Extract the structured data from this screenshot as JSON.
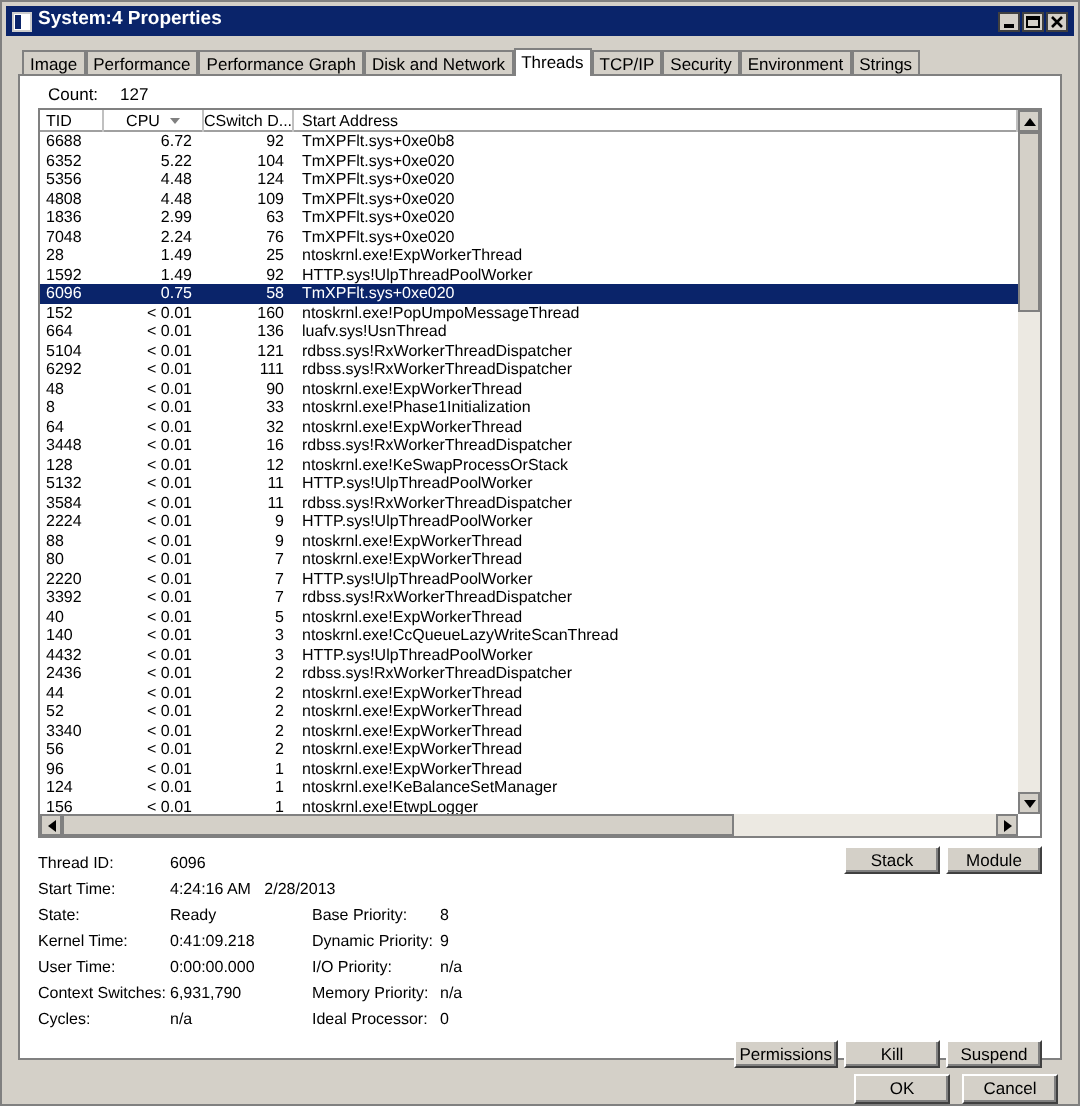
{
  "window": {
    "title": "System:4 Properties"
  },
  "tabs": [
    {
      "label": "Image",
      "selected": false
    },
    {
      "label": "Performance",
      "selected": false
    },
    {
      "label": "Performance Graph",
      "selected": false
    },
    {
      "label": "Disk and Network",
      "selected": false
    },
    {
      "label": "Threads",
      "selected": true
    },
    {
      "label": "TCP/IP",
      "selected": false
    },
    {
      "label": "Security",
      "selected": false
    },
    {
      "label": "Environment",
      "selected": false
    },
    {
      "label": "Strings",
      "selected": false
    }
  ],
  "count": {
    "label": "Count:",
    "value": "127"
  },
  "table": {
    "columns": [
      {
        "label": "TID",
        "sorted": false
      },
      {
        "label": "CPU",
        "sorted": true
      },
      {
        "label": "CSwitch D...",
        "sorted": false
      },
      {
        "label": "Start Address",
        "sorted": false
      }
    ],
    "rows": [
      {
        "cells": [
          "6688",
          "6.72",
          "92",
          "TmXPFlt.sys+0xe0b8"
        ],
        "selected": false
      },
      {
        "cells": [
          "6352",
          "5.22",
          "104",
          "TmXPFlt.sys+0xe020"
        ],
        "selected": false
      },
      {
        "cells": [
          "5356",
          "4.48",
          "124",
          "TmXPFlt.sys+0xe020"
        ],
        "selected": false
      },
      {
        "cells": [
          "4808",
          "4.48",
          "109",
          "TmXPFlt.sys+0xe020"
        ],
        "selected": false
      },
      {
        "cells": [
          "1836",
          "2.99",
          "63",
          "TmXPFlt.sys+0xe020"
        ],
        "selected": false
      },
      {
        "cells": [
          "7048",
          "2.24",
          "76",
          "TmXPFlt.sys+0xe020"
        ],
        "selected": false
      },
      {
        "cells": [
          "28",
          "1.49",
          "25",
          "ntoskrnl.exe!ExpWorkerThread"
        ],
        "selected": false
      },
      {
        "cells": [
          "1592",
          "1.49",
          "92",
          "HTTP.sys!UlpThreadPoolWorker"
        ],
        "selected": false
      },
      {
        "cells": [
          "6096",
          "0.75",
          "58",
          "TmXPFlt.sys+0xe020"
        ],
        "selected": true
      },
      {
        "cells": [
          "152",
          "< 0.01",
          "160",
          "ntoskrnl.exe!PopUmpoMessageThread"
        ],
        "selected": false
      },
      {
        "cells": [
          "664",
          "< 0.01",
          "136",
          "luafv.sys!UsnThread"
        ],
        "selected": false
      },
      {
        "cells": [
          "5104",
          "< 0.01",
          "121",
          "rdbss.sys!RxWorkerThreadDispatcher"
        ],
        "selected": false
      },
      {
        "cells": [
          "6292",
          "< 0.01",
          "111",
          "rdbss.sys!RxWorkerThreadDispatcher"
        ],
        "selected": false
      },
      {
        "cells": [
          "48",
          "< 0.01",
          "90",
          "ntoskrnl.exe!ExpWorkerThread"
        ],
        "selected": false
      },
      {
        "cells": [
          "8",
          "< 0.01",
          "33",
          "ntoskrnl.exe!Phase1Initialization"
        ],
        "selected": false
      },
      {
        "cells": [
          "64",
          "< 0.01",
          "32",
          "ntoskrnl.exe!ExpWorkerThread"
        ],
        "selected": false
      },
      {
        "cells": [
          "3448",
          "< 0.01",
          "16",
          "rdbss.sys!RxWorkerThreadDispatcher"
        ],
        "selected": false
      },
      {
        "cells": [
          "128",
          "< 0.01",
          "12",
          "ntoskrnl.exe!KeSwapProcessOrStack"
        ],
        "selected": false
      },
      {
        "cells": [
          "5132",
          "< 0.01",
          "11",
          "HTTP.sys!UlpThreadPoolWorker"
        ],
        "selected": false
      },
      {
        "cells": [
          "3584",
          "< 0.01",
          "11",
          "rdbss.sys!RxWorkerThreadDispatcher"
        ],
        "selected": false
      },
      {
        "cells": [
          "2224",
          "< 0.01",
          "9",
          "HTTP.sys!UlpThreadPoolWorker"
        ],
        "selected": false
      },
      {
        "cells": [
          "88",
          "< 0.01",
          "9",
          "ntoskrnl.exe!ExpWorkerThread"
        ],
        "selected": false
      },
      {
        "cells": [
          "80",
          "< 0.01",
          "7",
          "ntoskrnl.exe!ExpWorkerThread"
        ],
        "selected": false
      },
      {
        "cells": [
          "2220",
          "< 0.01",
          "7",
          "HTTP.sys!UlpThreadPoolWorker"
        ],
        "selected": false
      },
      {
        "cells": [
          "3392",
          "< 0.01",
          "7",
          "rdbss.sys!RxWorkerThreadDispatcher"
        ],
        "selected": false
      },
      {
        "cells": [
          "40",
          "< 0.01",
          "5",
          "ntoskrnl.exe!ExpWorkerThread"
        ],
        "selected": false
      },
      {
        "cells": [
          "140",
          "< 0.01",
          "3",
          "ntoskrnl.exe!CcQueueLazyWriteScanThread"
        ],
        "selected": false
      },
      {
        "cells": [
          "4432",
          "< 0.01",
          "3",
          "HTTP.sys!UlpThreadPoolWorker"
        ],
        "selected": false
      },
      {
        "cells": [
          "2436",
          "< 0.01",
          "2",
          "rdbss.sys!RxWorkerThreadDispatcher"
        ],
        "selected": false
      },
      {
        "cells": [
          "44",
          "< 0.01",
          "2",
          "ntoskrnl.exe!ExpWorkerThread"
        ],
        "selected": false
      },
      {
        "cells": [
          "52",
          "< 0.01",
          "2",
          "ntoskrnl.exe!ExpWorkerThread"
        ],
        "selected": false
      },
      {
        "cells": [
          "3340",
          "< 0.01",
          "2",
          "ntoskrnl.exe!ExpWorkerThread"
        ],
        "selected": false
      },
      {
        "cells": [
          "56",
          "< 0.01",
          "2",
          "ntoskrnl.exe!ExpWorkerThread"
        ],
        "selected": false
      },
      {
        "cells": [
          "96",
          "< 0.01",
          "1",
          "ntoskrnl.exe!ExpWorkerThread"
        ],
        "selected": false
      },
      {
        "cells": [
          "124",
          "< 0.01",
          "1",
          "ntoskrnl.exe!KeBalanceSetManager"
        ],
        "selected": false
      },
      {
        "cells": [
          "156",
          "< 0.01",
          "1",
          "ntoskrnl.exe!EtwpLogger"
        ],
        "selected": false
      }
    ]
  },
  "details": {
    "top": [
      {
        "label": "Thread ID:",
        "value": "6096"
      },
      {
        "label": "Start Time:",
        "value": "4:24:16 AM   2/28/2013"
      }
    ],
    "left": [
      {
        "label": "State:",
        "value": "Ready"
      },
      {
        "label": "Kernel Time:",
        "value": "0:41:09.218"
      },
      {
        "label": "User Time:",
        "value": "0:00:00.000"
      },
      {
        "label": "Context Switches:",
        "value": "6,931,790"
      },
      {
        "label": "Cycles:",
        "value": "n/a"
      }
    ],
    "right": [
      {
        "label": "Base Priority:",
        "value": "8"
      },
      {
        "label": "Dynamic Priority:",
        "value": "9"
      },
      {
        "label": "I/O Priority:",
        "value": "n/a"
      },
      {
        "label": "Memory Priority:",
        "value": "n/a"
      },
      {
        "label": "Ideal Processor:",
        "value": "0"
      }
    ]
  },
  "thread_buttons": [
    "Stack",
    "Module"
  ],
  "action_buttons": [
    "Permissions",
    "Kill",
    "Suspend"
  ],
  "dialog_buttons": [
    "OK",
    "Cancel"
  ]
}
